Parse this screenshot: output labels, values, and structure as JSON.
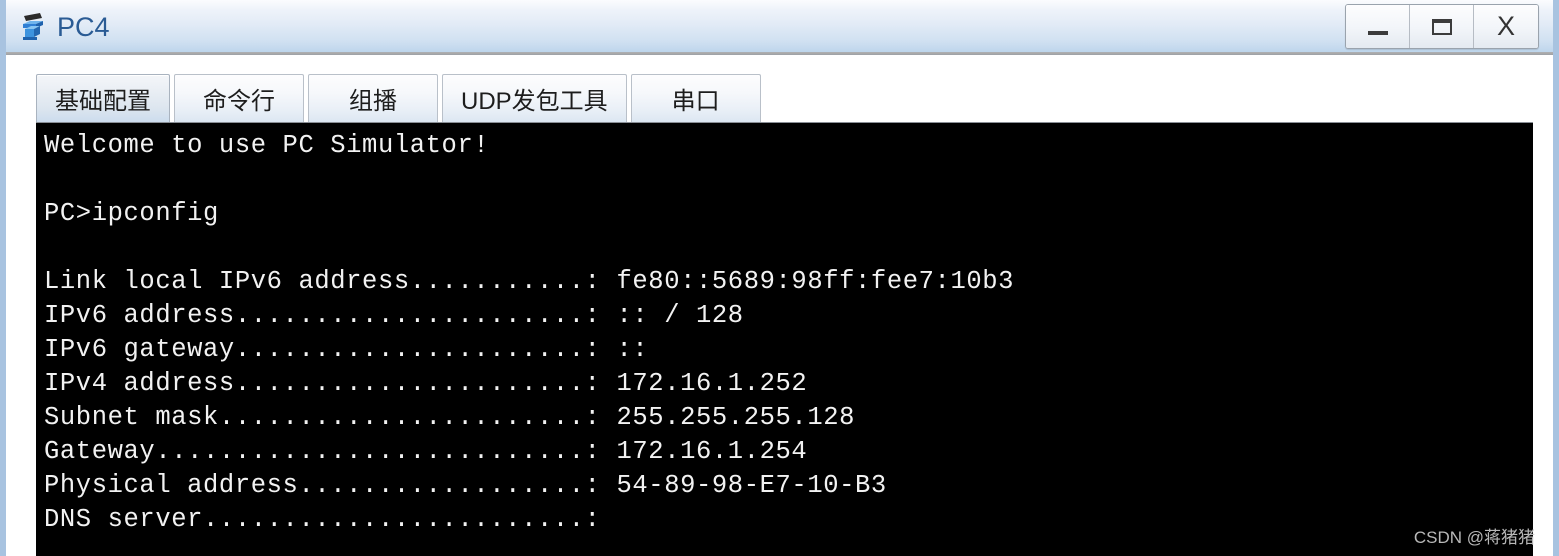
{
  "window": {
    "title": "PC4",
    "icon": "pc-device-icon",
    "accent_color": "#2a5b94",
    "titlebar_color": "#cfe0f1",
    "border_color": "#a8c3e0",
    "controls": [
      {
        "name": "minimize-button",
        "glyph": "minimize-icon",
        "label": "_"
      },
      {
        "name": "maximize-button",
        "glyph": "maximize-icon",
        "label": "□"
      },
      {
        "name": "close-button",
        "glyph": "close-icon",
        "label": "X"
      }
    ]
  },
  "tabs": [
    {
      "label": "基础配置",
      "name": "tab-basic-config",
      "active": true
    },
    {
      "label": "命令行",
      "name": "tab-command-line",
      "active": false
    },
    {
      "label": "组播",
      "name": "tab-multicast",
      "active": false
    },
    {
      "label": "UDP发包工具",
      "name": "tab-udp-tool",
      "active": false
    },
    {
      "label": "串口",
      "name": "tab-serial-port",
      "active": false
    }
  ],
  "terminal": {
    "background_color": "#000000",
    "text_color": "#f2f2f2",
    "banner": "Welcome to use PC Simulator!",
    "prompt": "PC>",
    "command": "ipconfig",
    "output_lines": [
      {
        "label": "Link local IPv6 address",
        "dots": "...........",
        "value": "fe80::5689:98ff:fee7:10b3"
      },
      {
        "label": "IPv6 address",
        "dots": "......................",
        "value": ":: / 128"
      },
      {
        "label": "IPv6 gateway",
        "dots": "......................",
        "value": "::"
      },
      {
        "label": "IPv4 address",
        "dots": "......................",
        "value": "172.16.1.252"
      },
      {
        "label": "Subnet mask",
        "dots": ".......................",
        "value": "255.255.255.128"
      },
      {
        "label": "Gateway",
        "dots": "...........................",
        "value": "172.16.1.254"
      },
      {
        "label": "Physical address",
        "dots": "..................",
        "value": "54-89-98-E7-10-B3"
      },
      {
        "label": "DNS server",
        "dots": "........................",
        "value": ""
      }
    ],
    "full_text": "Welcome to use PC Simulator!\n\nPC>ipconfig\n\nLink local IPv6 address...........: fe80::5689:98ff:fee7:10b3\nIPv6 address......................: :: / 128\nIPv6 gateway......................: ::\nIPv4 address......................: 172.16.1.252\nSubnet mask.......................: 255.255.255.128\nGateway...........................: 172.16.1.254\nPhysical address..................: 54-89-98-E7-10-B3\nDNS server........................:"
  },
  "watermark": {
    "text": "CSDN @蒋猪猪"
  }
}
